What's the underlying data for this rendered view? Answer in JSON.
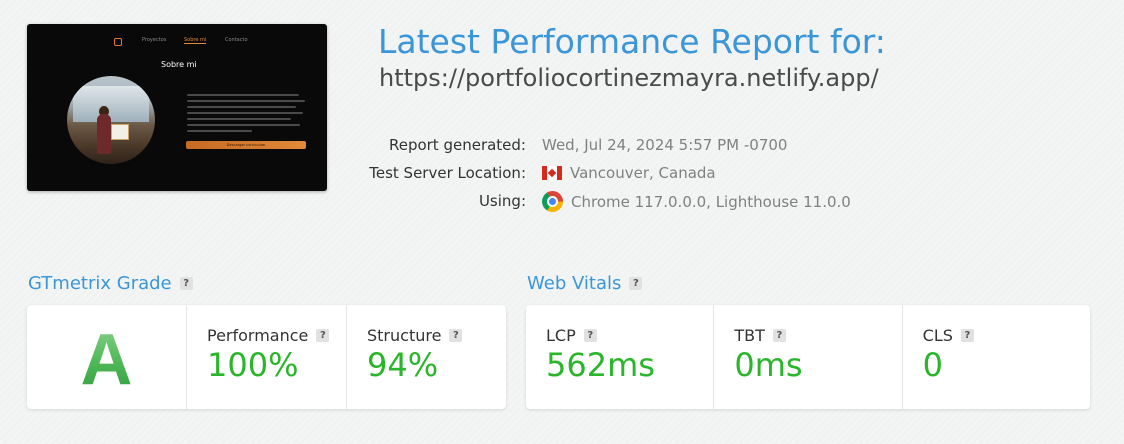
{
  "thumbnail": {
    "nav": [
      "Proyectos",
      "Sobre mi",
      "Contacto"
    ],
    "heading": "Sobre mi",
    "button_label": "Descargar curriculum"
  },
  "report": {
    "title": "Latest Performance Report for:",
    "url": "https://portfoliocortinezmayra.netlify.app/",
    "generated_label": "Report generated:",
    "generated_value": "Wed, Jul 24, 2024 5:57 PM -0700",
    "location_label": "Test Server Location:",
    "location_value": "Vancouver, Canada",
    "using_label": "Using:",
    "using_value": "Chrome 117.0.0.0, Lighthouse 11.0.0"
  },
  "grade_section": {
    "title": "GTmetrix Grade",
    "grade": "A",
    "performance_label": "Performance",
    "performance_value": "100%",
    "structure_label": "Structure",
    "structure_value": "94%"
  },
  "vitals_section": {
    "title": "Web Vitals",
    "lcp_label": "LCP",
    "lcp_value": "562ms",
    "tbt_label": "TBT",
    "tbt_value": "0ms",
    "cls_label": "CLS",
    "cls_value": "0"
  },
  "help_glyph": "?",
  "colors": {
    "accent_blue": "#3a96d8",
    "good_green": "#2bb52b",
    "grade_green": "#4fbe5b"
  }
}
